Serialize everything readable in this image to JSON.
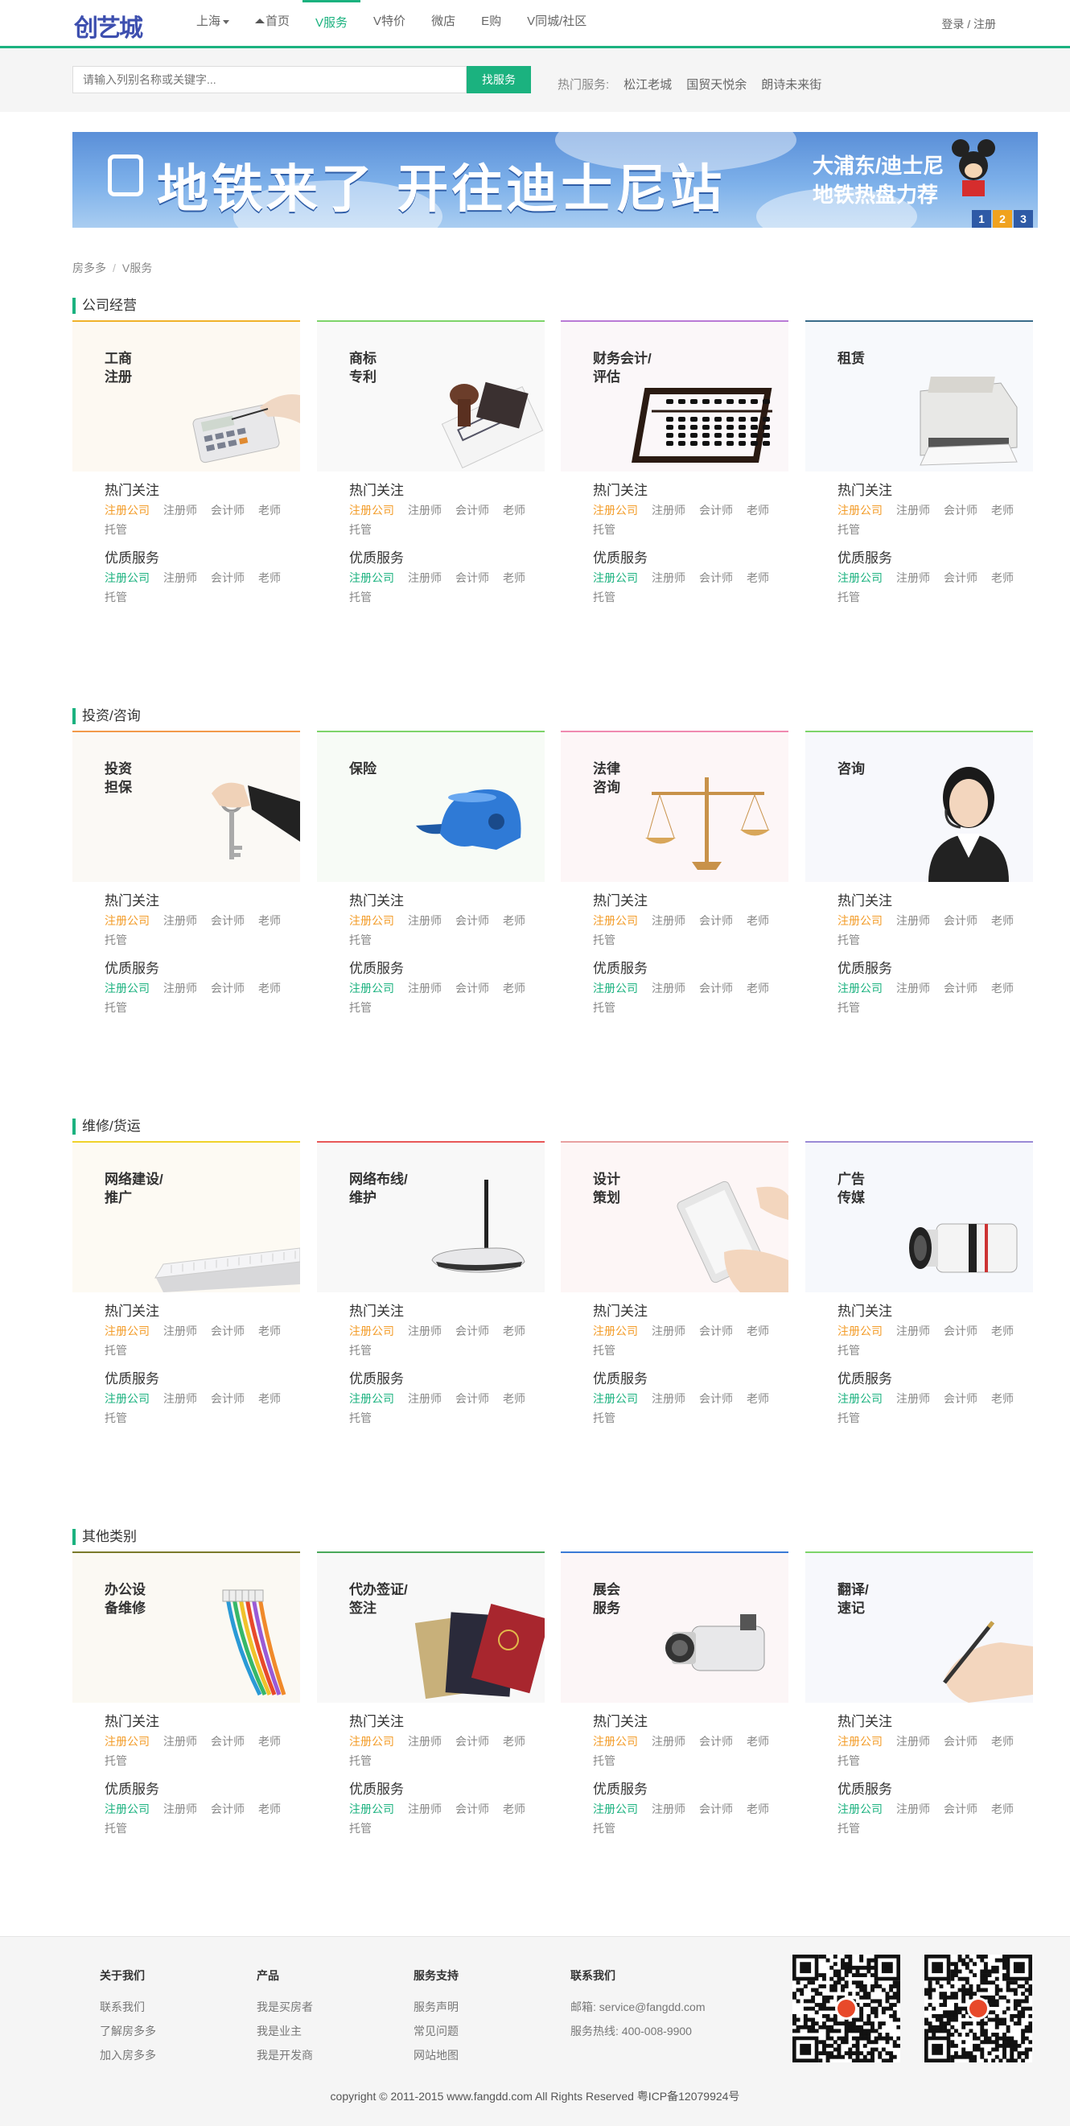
{
  "header": {
    "logo": "创艺城",
    "nav": [
      {
        "label": "上海",
        "dropdown": true
      },
      {
        "label": "首页",
        "icon": "home-icon"
      },
      {
        "label": "V服务",
        "active": true
      },
      {
        "label": "V特价"
      },
      {
        "label": "微店"
      },
      {
        "label": "E购"
      },
      {
        "label": "V同城/社区"
      }
    ],
    "login": "登录 / 注册"
  },
  "search": {
    "placeholder": "请输入列别名称或关键字...",
    "button": "找服务",
    "hot_label": "热门服务:",
    "hot_links": [
      "松江老城",
      "国贸天悦余",
      "朗诗未来街"
    ]
  },
  "banner": {
    "title": "地铁来了 开往迪士尼站",
    "subtitle_1": "大浦东/迪士尼",
    "subtitle_2": "地铁热盘力荐",
    "pages": [
      "1",
      "2",
      "3"
    ]
  },
  "breadcrumb": [
    "房多多",
    "V服务"
  ],
  "tag_labels": {
    "hot": "热门关注",
    "quality": "优质服务",
    "items": [
      "注册公司",
      "注册师",
      "会计师",
      "老师",
      "托管"
    ]
  },
  "sections": [
    {
      "title": "公司经营",
      "cards": [
        {
          "name": "工商\n注册",
          "icon": "calculator-icon"
        },
        {
          "name": "商标\n专利",
          "icon": "stamp-icon"
        },
        {
          "name": "财务会计/\n评估",
          "icon": "abacus-icon"
        },
        {
          "name": "租赁",
          "icon": "printer-icon"
        }
      ]
    },
    {
      "title": "投资/咨询",
      "cards": [
        {
          "name": "投资\n担保",
          "icon": "key-icon"
        },
        {
          "name": "保险",
          "icon": "helmet-icon"
        },
        {
          "name": "法律\n咨询",
          "icon": "scales-icon"
        },
        {
          "name": "咨询",
          "icon": "headset-agent-icon"
        }
      ]
    },
    {
      "title": "维修/货运",
      "cards": [
        {
          "name": "网络建设/\n推广",
          "icon": "keyboard-icon"
        },
        {
          "name": "网络布线/\n维护",
          "icon": "router-icon"
        },
        {
          "name": "设计\n策划",
          "icon": "tablet-icon"
        },
        {
          "name": "广告\n传媒",
          "icon": "camera-lens-icon"
        }
      ]
    },
    {
      "title": "其他类别",
      "cards": [
        {
          "name": "办公设\n备维修",
          "icon": "cables-icon"
        },
        {
          "name": "代办签证/\n签注",
          "icon": "passport-icon"
        },
        {
          "name": "展会\n服务",
          "icon": "camcorder-icon"
        },
        {
          "name": "翻译/\n速记",
          "icon": "pen-hand-icon"
        }
      ]
    }
  ],
  "footer": {
    "columns": [
      {
        "title": "关于我们",
        "links": [
          "联系我们",
          "了解房多多",
          "加入房多多"
        ]
      },
      {
        "title": "产品",
        "links": [
          "我是买房者",
          "我是业主",
          "我是开发商"
        ]
      },
      {
        "title": "服务支持",
        "links": [
          "服务声明",
          "常见问题",
          "网站地图"
        ]
      },
      {
        "title": "联系我们",
        "links": [
          "邮箱: service@fangdd.com",
          "服务热线: 400-008-9900"
        ]
      }
    ],
    "copyright": "copyright © 2011-2015 www.fangdd.com All Rights Reserved 粤ICP备12079924号"
  },
  "colors": {
    "accent": "#1bb27f",
    "tag_orange": "#f39c28"
  }
}
